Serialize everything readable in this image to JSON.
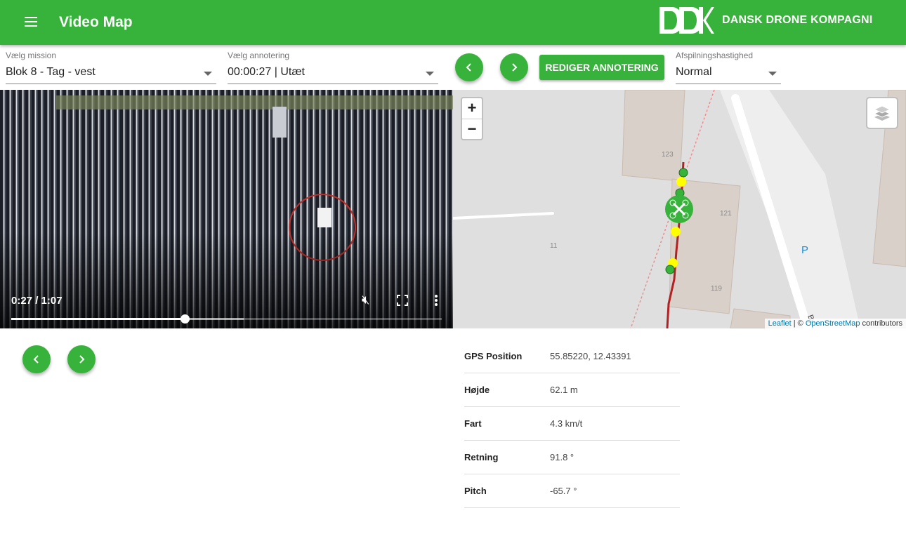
{
  "header": {
    "title": "Video Map",
    "brand": "DANSK DRONE KOMPAGNI",
    "logo": "DDK"
  },
  "toolbar": {
    "mission": {
      "label": "Vælg mission",
      "value": "Blok 8 - Tag - vest"
    },
    "annotation": {
      "label": "Vælg annotering",
      "value": "00:00:27 | Utæt"
    },
    "edit_button": "REDIGER ANNOTERING",
    "speed": {
      "label": "Afspilningshastighed",
      "value": "Normal"
    }
  },
  "video": {
    "time": "0:27 / 1:07",
    "progress": 0.403,
    "buffered": 0.54,
    "muted": true
  },
  "map": {
    "zoom_in": "+",
    "zoom_out": "−",
    "labels": {
      "b123": "123",
      "b121": "121",
      "b119": "119",
      "n11": "11",
      "parking": "P",
      "road": "By"
    },
    "attribution": {
      "leaflet": "Leaflet",
      "sep": " | © ",
      "osm": "OpenStreetMap",
      "suffix": " contributors"
    }
  },
  "telemetry": [
    {
      "key": "GPS Position",
      "value": "55.85220, 12.43391"
    },
    {
      "key": "Højde",
      "value": "62.1 m"
    },
    {
      "key": "Fart",
      "value": "4.3 km/t"
    },
    {
      "key": "Retning",
      "value": "91.8 °"
    },
    {
      "key": "Pitch",
      "value": "-65.7 °"
    }
  ],
  "colors": {
    "brand": "#37b23a",
    "track": "#b22222",
    "marker_yellow": "#ffff00"
  }
}
